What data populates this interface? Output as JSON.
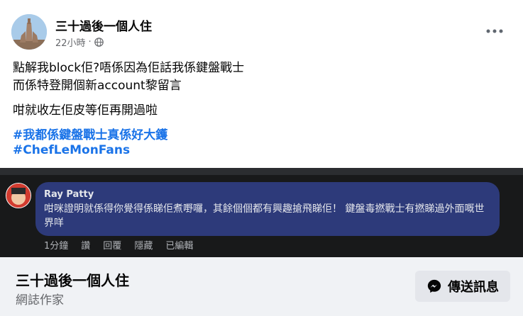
{
  "post": {
    "author": "三十過後一個人住",
    "time": "22小時",
    "separator": "·",
    "lines": [
      "點解我block佢?唔係因為佢話我係鍵盤戰士",
      "而係特登開個新account黎留言",
      "咁就收左佢皮等佢再開過啦"
    ],
    "hashtags": [
      "#我都係鍵盤戰士真係好大鑊",
      "#ChefLeMonFans"
    ]
  },
  "comment": {
    "name": "Ray Patty",
    "text": "咁咪證明就係得你覺得係睇佢煮嘢囉，其餘個個都有興趣搶飛睇佢！ 鍵盤毒撚戰士有撚睇過外面嘅世界咩",
    "actions": [
      "1分鐘",
      "讚",
      "回覆",
      "隱藏",
      "已編輯"
    ]
  },
  "footer": {
    "name": "三十過後一個人住",
    "subtitle": "網誌作家",
    "message_button": "傳送訊息"
  },
  "icons": {
    "more": "more-options-icon",
    "audience": "globe-icon",
    "messenger": "messenger-icon"
  },
  "colors": {
    "link": "#1a73e8",
    "bubble": "#2d3a7a"
  }
}
